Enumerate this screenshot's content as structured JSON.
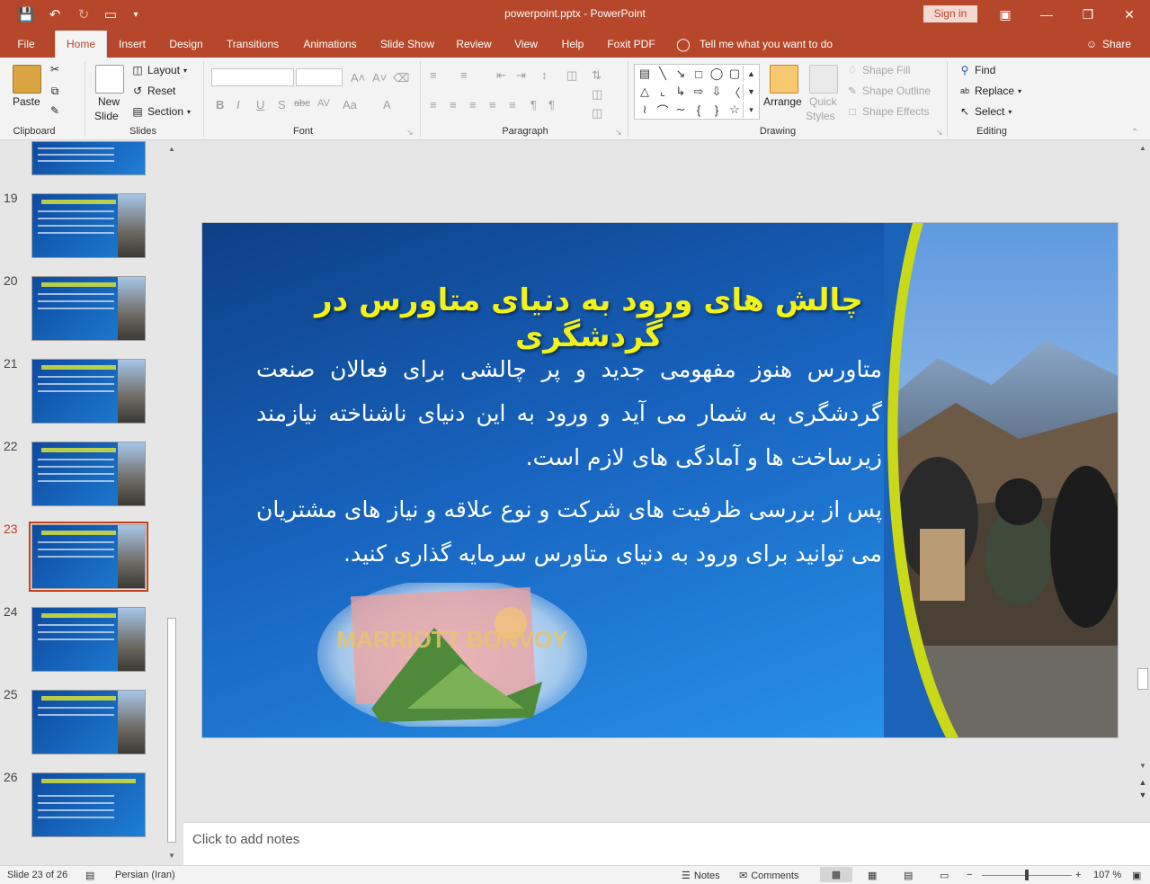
{
  "window": {
    "title": "powerpoint.pptx  -  PowerPoint",
    "signin_label": "Sign in"
  },
  "tabs": [
    "File",
    "Home",
    "Insert",
    "Design",
    "Transitions",
    "Animations",
    "Slide Show",
    "Review",
    "View",
    "Help",
    "Foxit PDF"
  ],
  "tell_me": "Tell me what you want to do",
  "share_label": "Share",
  "ribbon": {
    "clipboard": {
      "paste": "Paste",
      "label": "Clipboard"
    },
    "slides": {
      "new_slide_1": "New",
      "new_slide_2": "Slide",
      "layout": "Layout",
      "reset": "Reset",
      "section": "Section",
      "label": "Slides"
    },
    "font": {
      "label": "Font",
      "bold": "B",
      "italic": "I",
      "underline": "U",
      "shadow": "S",
      "strike": "abc",
      "spacing": "AV",
      "case": "Aa",
      "color": "A"
    },
    "paragraph": {
      "label": "Paragraph"
    },
    "drawing": {
      "arrange": "Arrange",
      "quick_styles_1": "Quick",
      "quick_styles_2": "Styles",
      "shape_fill": "Shape Fill",
      "shape_outline": "Shape Outline",
      "shape_effects": "Shape Effects",
      "label": "Drawing"
    },
    "editing": {
      "find": "Find",
      "replace": "Replace",
      "select": "Select",
      "label": "Editing"
    }
  },
  "thumbnails": [
    {
      "num": "19",
      "selected": false
    },
    {
      "num": "20",
      "selected": false
    },
    {
      "num": "21",
      "selected": false
    },
    {
      "num": "22",
      "selected": false
    },
    {
      "num": "23",
      "selected": true
    },
    {
      "num": "24",
      "selected": false
    },
    {
      "num": "25",
      "selected": false
    },
    {
      "num": "26",
      "selected": false
    }
  ],
  "slide": {
    "title": "چالش های ورود به دنیای متاورس در گردشگری",
    "para1": "متاورس هنوز مفهومی جدید و پر چالشی برای فعالان صنعت گردشگری به شمار می آید و ورود به این دنیای ناشناخته نیازمند زیرساخت ها و آمادگی های لازم است.",
    "para2": "پس از بررسی ظرفیت های شرکت و نوع علاقه و نیاز های مشتریان می توانید برای ورود به دنیای متاورس سرمایه گذاری کنید.",
    "image_text": "MARRIOTT BONVOY"
  },
  "notes_placeholder": "Click to add notes",
  "status": {
    "slide_count": "Slide 23 of 26",
    "language": "Persian (Iran)",
    "notes": "Notes",
    "comments": "Comments",
    "zoom": "107 %"
  }
}
